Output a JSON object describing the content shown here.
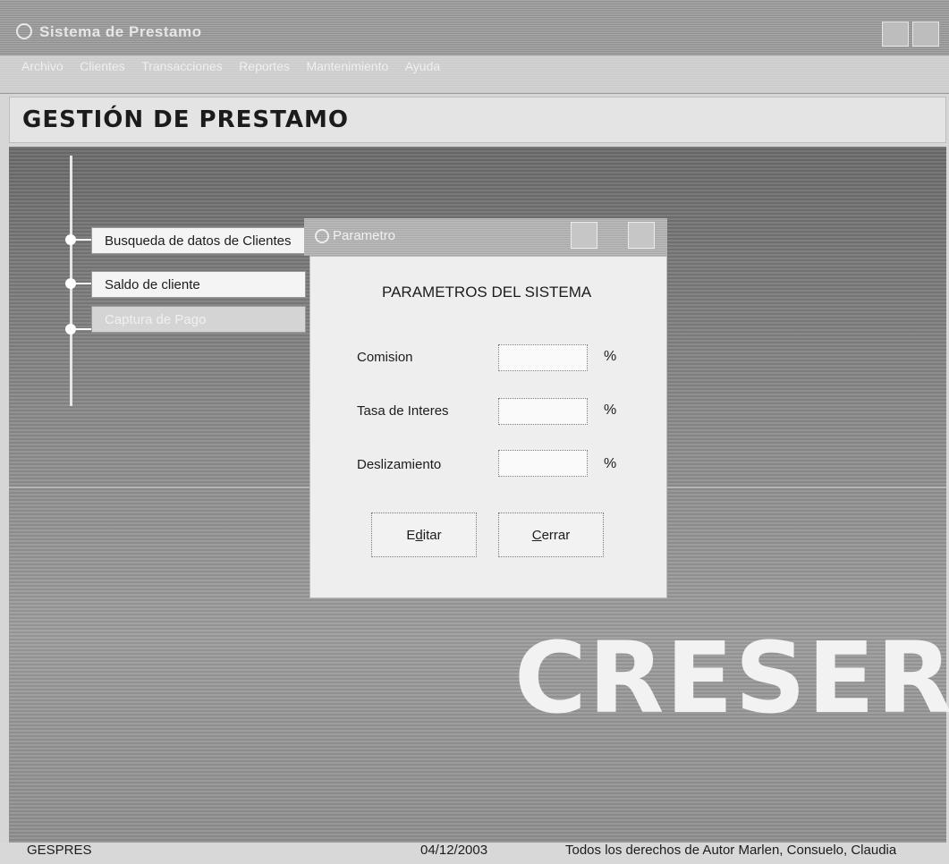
{
  "window": {
    "title": "Sistema de Prestamo",
    "title_icon": "app-icon"
  },
  "menubar": {
    "items": [
      "Archivo",
      "Clientes",
      "Transacciones",
      "Reportes",
      "Mantenimiento",
      "Ayuda"
    ]
  },
  "header": {
    "title": "GESTIÓN DE PRESTAMO"
  },
  "nav": {
    "items": [
      {
        "label": "Busqueda de datos de Clientes",
        "enabled": true
      },
      {
        "label": "Saldo de cliente",
        "enabled": true
      },
      {
        "label": "Captura de Pago",
        "enabled": false
      }
    ]
  },
  "watermark": "CRESER",
  "dialog": {
    "title": "Parametro",
    "heading": "PARAMETROS DEL SISTEMA",
    "fields": [
      {
        "label": "Comision",
        "value": "",
        "unit": "%"
      },
      {
        "label": "Tasa de Interes",
        "value": "",
        "unit": "%"
      },
      {
        "label": "Deslizamiento",
        "value": "",
        "unit": "%"
      }
    ],
    "edit_button": {
      "label": "Editar",
      "mnemonic": "d",
      "pre": "E",
      "post": "itar"
    },
    "close_button": {
      "label": "Cerrar",
      "mnemonic": "C",
      "pre": "",
      "post": "errar"
    }
  },
  "statusbar": {
    "app": "GESPRES",
    "date": "04/12/2003",
    "copyright": "Todos los derechos de Autor Marlen, Consuelo, Claudia"
  },
  "colors": {
    "header_bg": "#e4e4e4",
    "dialog_bg": "#eeeeee",
    "watermark": "#f2f2f2"
  }
}
